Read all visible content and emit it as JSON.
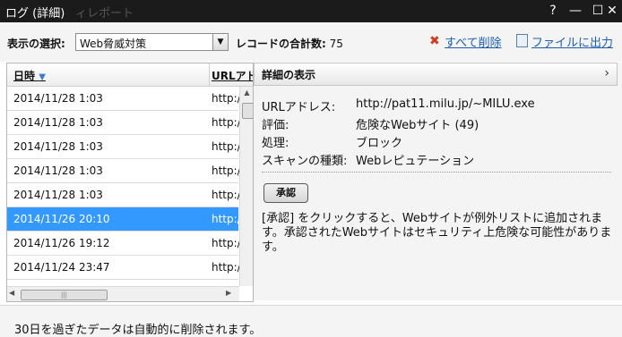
{
  "window": {
    "title": "ログ (詳細)",
    "ghost_title": "ィレポート",
    "help_label": "?",
    "minimize_label": "—",
    "maximize_label": "☐",
    "close_label": "✕"
  },
  "toolbar": {
    "filter_label": "表示の選択:",
    "filter_selected": "Web脅威対策",
    "total_label": "レコードの合計数:",
    "total_count": "75",
    "delete_all_label": "すべて削除",
    "export_label": "ファイルに出力"
  },
  "list": {
    "col_date": "日時",
    "col_url": "URLアドレス",
    "rows": [
      {
        "date": "2014/11/28 1:03",
        "url": "http:/"
      },
      {
        "date": "2014/11/28 1:03",
        "url": "http:/"
      },
      {
        "date": "2014/11/28 1:03",
        "url": "http:/"
      },
      {
        "date": "2014/11/28 1:03",
        "url": "http:/"
      },
      {
        "date": "2014/11/28 1:03",
        "url": "http:/"
      },
      {
        "date": "2014/11/26 20:10",
        "url": "http:/"
      },
      {
        "date": "2014/11/26 19:12",
        "url": "http:/"
      },
      {
        "date": "2014/11/24 23:47",
        "url": "http:/"
      }
    ],
    "selected_index": 5
  },
  "detail": {
    "title": "詳細の表示",
    "fields": [
      {
        "key": "URLアドレス:",
        "value": "http://pat11.milu.jp/~MILU.exe"
      },
      {
        "key": "評価:",
        "value": "危険なWebサイト (49)"
      },
      {
        "key": "処理:",
        "value": "ブロック"
      },
      {
        "key": "スキャンの種類:",
        "value": "Webレピュテーション"
      }
    ],
    "approve_label": "承認",
    "note": "[承認] をクリックすると、Webサイトが例外リストに追加されます。承認されたWebサイトはセキュリティ上危険な可能性があります。"
  },
  "footer": {
    "text": "30日を過ぎたデータは自動的に削除されます。"
  },
  "colors": {
    "selection": "#3399ff",
    "link": "#1a5fb4",
    "titlebar": "#1b1b1b"
  }
}
